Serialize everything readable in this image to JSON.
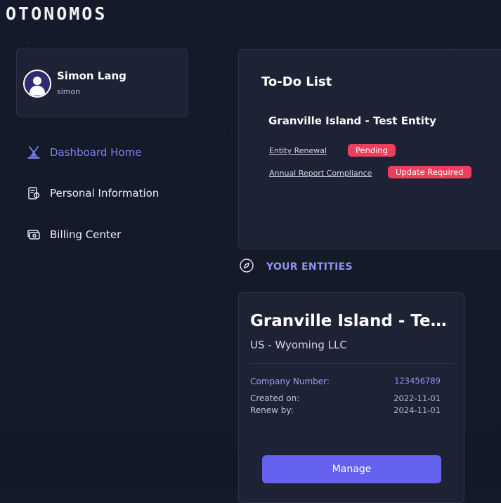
{
  "brand": {
    "logo_text": "OTONOMOS"
  },
  "profile": {
    "name": "Simon Lang",
    "username": "simon"
  },
  "sidebar": {
    "items": [
      {
        "label": "Dashboard Home",
        "icon": "tent-icon",
        "active": true
      },
      {
        "label": "Personal Information",
        "icon": "id-badge-icon",
        "active": false
      },
      {
        "label": "Billing Center",
        "icon": "cash-icon",
        "active": false
      }
    ]
  },
  "todo": {
    "title": "To-Do List",
    "entity": "Granville Island - Test Entity",
    "tasks": [
      {
        "label": "Entity Renewal",
        "status": "Pending"
      },
      {
        "label": "Annual Report Compliance",
        "status": "Update Required"
      }
    ]
  },
  "entities_section": {
    "title": "YOUR ENTITIES",
    "icon": "compass-icon"
  },
  "entity": {
    "name": "Granville Island - Test Entity",
    "type": "US - Wyoming LLC",
    "company_number_label": "Company Number:",
    "company_number": "123456789",
    "created_label": "Created on:",
    "created": "2022-11-01",
    "renew_label": "Renew by:",
    "renew": "2024-11-01",
    "manage_label": "Manage"
  },
  "colors": {
    "accent": "#6562ef",
    "accent_text": "#8e94f0",
    "badge": "#ee3e5c",
    "card_bg": "#1d2234",
    "page_bg": "#141a29"
  }
}
